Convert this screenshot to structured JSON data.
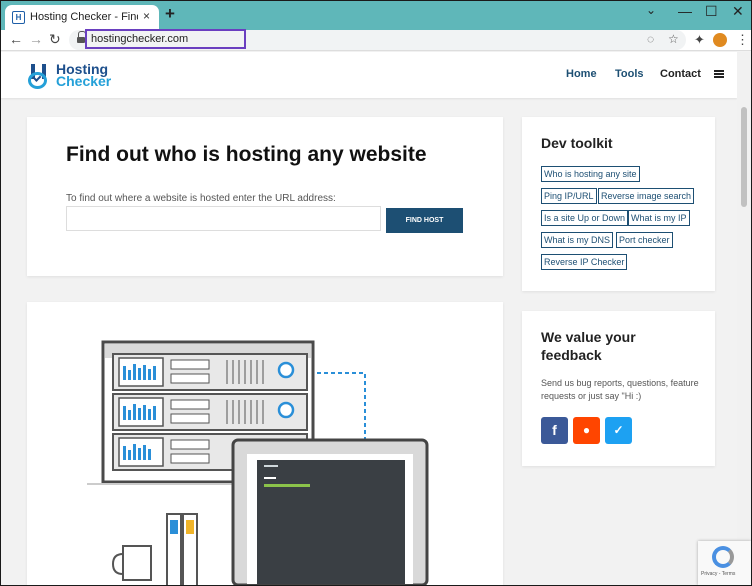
{
  "browser": {
    "tab_title": "Hosting Checker - Find out who",
    "tab_favicon": "H",
    "tab_close": "×",
    "new_tab": "+",
    "url": "hostingchecker.com",
    "win_minimize": "—",
    "win_maximize": "☐",
    "win_close": "✕",
    "win_chevron": "⌄",
    "back": "←",
    "forward": "→",
    "reload": "↻",
    "eye_off_icon": "◌",
    "star_icon": "☆",
    "extensions_icon": "✦",
    "menu_icon": "⋮"
  },
  "site": {
    "logo_line1": "Hosting",
    "logo_line2": "Checker",
    "nav": [
      {
        "label": "Home"
      },
      {
        "label": "Tools"
      },
      {
        "label": "Contact"
      }
    ]
  },
  "hero": {
    "title": "Find out who is hosting any website",
    "hint": "To find out where a website is hosted enter the URL address:",
    "input_value": "",
    "button_label": "FIND HOST"
  },
  "toolkit": {
    "title": "Dev toolkit",
    "links": [
      "Who is hosting any site",
      "Ping IP/URL",
      "Reverse image search",
      "Is a site Up or Down",
      "What is my IP",
      "What is my DNS",
      "Port checker",
      "Reverse IP Checker"
    ]
  },
  "feedback": {
    "title_line1": "We value your",
    "title_line2": "feedback",
    "text": "Send us bug reports, questions, feature requests or just say \"Hi :)",
    "facebook_glyph": "f",
    "reddit_glyph": "●",
    "twitter_glyph": "✓"
  },
  "recaptcha": {
    "footer": "Privacy - Terms"
  },
  "colors": {
    "tabstrip": "#5fb7b9",
    "primary": "#1d4f73",
    "logo_blue": "#1d4f8c",
    "logo_cyan": "#24a0d8",
    "facebook": "#3b5998",
    "reddit": "#ff4500",
    "twitter": "#1da1f2",
    "url_highlight": "#6a3fc0"
  }
}
